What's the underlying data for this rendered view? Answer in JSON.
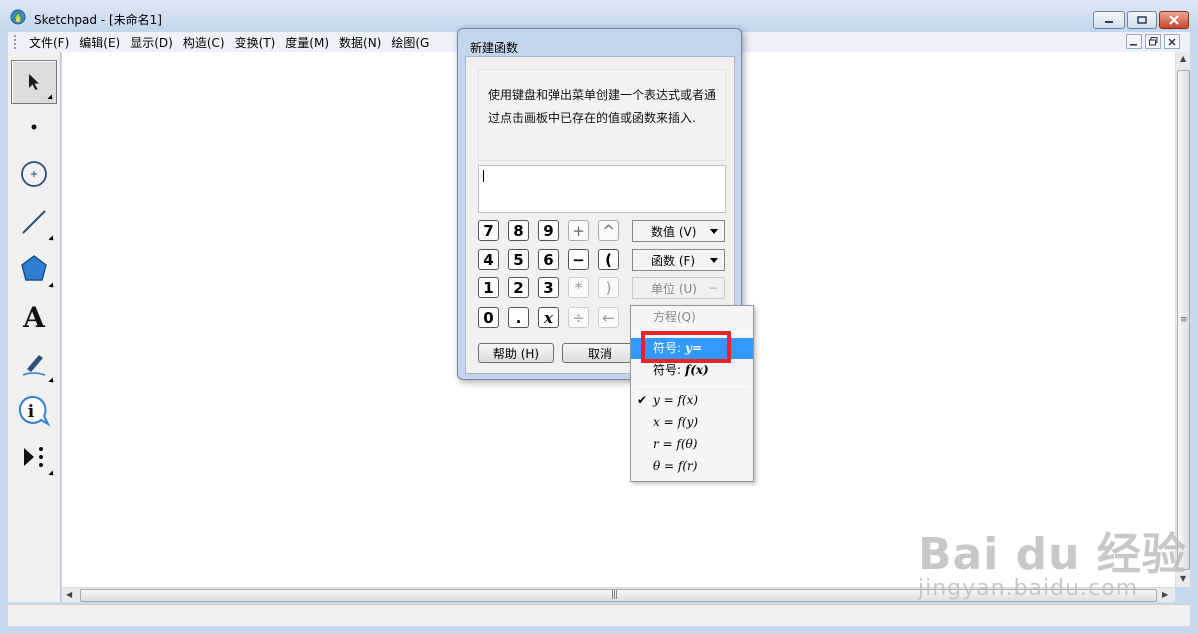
{
  "window": {
    "title": "Sketchpad  - [未命名1]"
  },
  "menubar": {
    "items": [
      "文件(F)",
      "编辑(E)",
      "显示(D)",
      "构造(C)",
      "变换(T)",
      "度量(M)",
      "数据(N)",
      "绘图(G"
    ]
  },
  "toolbar": {
    "tools": [
      "arrow-tool",
      "point-tool",
      "compass-tool",
      "straightedge-tool",
      "polygon-tool",
      "text-tool",
      "marker-tool",
      "information-tool",
      "custom-tool"
    ],
    "text_tool_glyph": "A"
  },
  "dialog": {
    "title": "新建函数",
    "description": "使用键盘和弹出菜单创建一个表达式或者通过点击画板中已存在的值或函数来插入.",
    "expression_value": "",
    "keypad": {
      "row1": [
        "7",
        "8",
        "9",
        "+",
        "^"
      ],
      "row2": [
        "4",
        "5",
        "6",
        "−",
        "("
      ],
      "row3": [
        "1",
        "2",
        "3",
        "*",
        ")"
      ],
      "row4": [
        "0",
        ".",
        "x",
        "÷",
        "←"
      ]
    },
    "values_button": "数值 (V)",
    "functions_button": "函数 (F)",
    "units_button": "单位 (U)",
    "units_dash": "−",
    "help_button": "帮助 (H)",
    "cancel_button": "取消"
  },
  "context_menu": {
    "items": [
      {
        "label": "方程(Q)",
        "disabled": true
      },
      {
        "label": "符号:",
        "math": "y=",
        "highlighted": true
      },
      {
        "label": "符号:",
        "math": "f(x)"
      },
      {
        "label": "y = f(x)",
        "checked": true
      },
      {
        "label": "x = f(y)"
      },
      {
        "label": "r = f(θ)"
      },
      {
        "label": "θ = f(r)"
      }
    ]
  },
  "scrollbar": {
    "h_grip": "|||",
    "v_grip": "≡"
  },
  "watermark": {
    "logo": "Bai du 经验",
    "url": "jingyan.baidu.com"
  },
  "colors": {
    "highlight": "#3399ff",
    "callout": "#e8232a",
    "chrome": "#c4d6ec"
  }
}
